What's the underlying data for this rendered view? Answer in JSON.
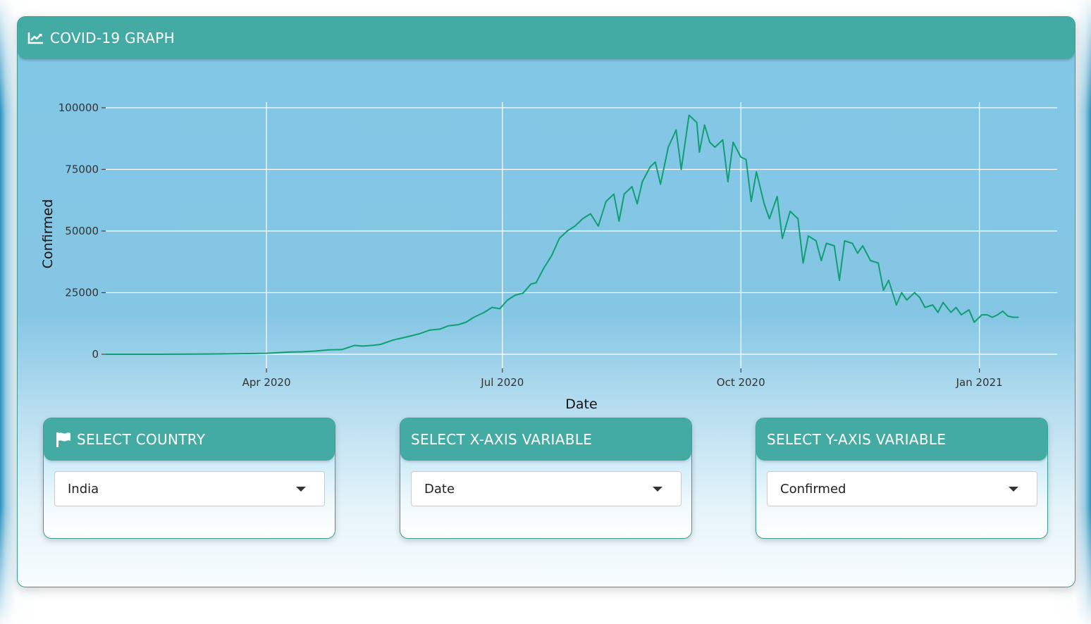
{
  "header": {
    "title": "COVID-19 GRAPH",
    "icon": "line-chart-icon"
  },
  "selectors": {
    "country": {
      "title": "SELECT COUNTRY",
      "icon": "flag-icon",
      "value": "India"
    },
    "x_axis": {
      "title": "SELECT X-AXIS VARIABLE",
      "value": "Date"
    },
    "y_axis": {
      "title": "SELECT Y-AXIS VARIABLE",
      "value": "Confirmed"
    }
  },
  "colors": {
    "accent": "#43aba4",
    "line": "#109f72",
    "grid": "#ffffff"
  },
  "chart_data": {
    "type": "line",
    "title": "",
    "xlabel": "Date",
    "ylabel": "Confirmed",
    "grid": true,
    "xlim": [
      "2020-01-30",
      "2021-01-31"
    ],
    "ylim": [
      0,
      100000
    ],
    "x_ticks": [
      {
        "date": "2020-04-01",
        "label": "Apr 2020"
      },
      {
        "date": "2020-07-01",
        "label": "Jul 2020"
      },
      {
        "date": "2020-10-01",
        "label": "Oct 2020"
      },
      {
        "date": "2021-01-01",
        "label": "Jan 2021"
      }
    ],
    "y_ticks": [
      {
        "value": 0,
        "label": "0"
      },
      {
        "value": 25000,
        "label": "25000"
      },
      {
        "value": 50000,
        "label": "50000"
      },
      {
        "value": 75000,
        "label": "75000"
      },
      {
        "value": 100000,
        "label": "100000"
      }
    ],
    "series": [
      {
        "x": [
          "2020-01-30",
          "2020-02-20",
          "2020-03-10",
          "2020-03-20",
          "2020-04-01",
          "2020-04-10",
          "2020-04-15",
          "2020-04-20",
          "2020-04-25",
          "2020-04-30",
          "2020-05-05",
          "2020-05-08",
          "2020-05-12",
          "2020-05-15",
          "2020-05-20",
          "2020-05-25",
          "2020-05-30",
          "2020-06-03",
          "2020-06-07",
          "2020-06-10",
          "2020-06-14",
          "2020-06-17",
          "2020-06-20",
          "2020-06-24",
          "2020-06-27",
          "2020-06-30",
          "2020-07-03",
          "2020-07-06",
          "2020-07-09",
          "2020-07-12",
          "2020-07-14",
          "2020-07-17",
          "2020-07-20",
          "2020-07-23",
          "2020-07-26",
          "2020-07-29",
          "2020-08-01",
          "2020-08-04",
          "2020-08-07",
          "2020-08-10",
          "2020-08-13",
          "2020-08-15",
          "2020-08-17",
          "2020-08-20",
          "2020-08-22",
          "2020-08-24",
          "2020-08-27",
          "2020-08-29",
          "2020-08-31",
          "2020-09-03",
          "2020-09-06",
          "2020-09-08",
          "2020-09-11",
          "2020-09-14",
          "2020-09-15",
          "2020-09-17",
          "2020-09-19",
          "2020-09-21",
          "2020-09-24",
          "2020-09-26",
          "2020-09-28",
          "2020-10-01",
          "2020-10-03",
          "2020-10-05",
          "2020-10-07",
          "2020-10-10",
          "2020-10-12",
          "2020-10-15",
          "2020-10-17",
          "2020-10-20",
          "2020-10-23",
          "2020-10-25",
          "2020-10-27",
          "2020-10-30",
          "2020-11-01",
          "2020-11-03",
          "2020-11-06",
          "2020-11-08",
          "2020-11-10",
          "2020-11-13",
          "2020-11-15",
          "2020-11-17",
          "2020-11-20",
          "2020-11-23",
          "2020-11-25",
          "2020-11-27",
          "2020-11-30",
          "2020-12-02",
          "2020-12-04",
          "2020-12-07",
          "2020-12-09",
          "2020-12-11",
          "2020-12-14",
          "2020-12-16",
          "2020-12-18",
          "2020-12-21",
          "2020-12-23",
          "2020-12-25",
          "2020-12-28",
          "2020-12-30",
          "2021-01-02",
          "2021-01-04",
          "2021-01-06",
          "2021-01-08",
          "2021-01-10",
          "2021-01-12",
          "2021-01-14",
          "2021-01-16"
        ],
        "y": [
          0,
          0,
          100,
          200,
          400,
          900,
          1000,
          1300,
          1800,
          1900,
          3600,
          3300,
          3600,
          4000,
          5800,
          7000,
          8300,
          9800,
          10200,
          11500,
          12000,
          13000,
          15000,
          17000,
          19000,
          18500,
          22000,
          24000,
          24800,
          28500,
          29000,
          35000,
          40000,
          47000,
          50000,
          52000,
          55000,
          57000,
          52000,
          62000,
          65000,
          54000,
          65000,
          68000,
          61000,
          70000,
          76000,
          78000,
          69000,
          84000,
          91000,
          75000,
          97000,
          94000,
          82000,
          93000,
          86000,
          84000,
          87000,
          70000,
          86000,
          80000,
          79000,
          62000,
          74000,
          61000,
          55000,
          64000,
          47000,
          58000,
          55000,
          37000,
          48000,
          46000,
          38000,
          45000,
          44000,
          30000,
          46000,
          45000,
          41000,
          44000,
          38000,
          37000,
          26000,
          30000,
          20000,
          25000,
          22000,
          25000,
          23000,
          19000,
          20000,
          17000,
          21000,
          17000,
          19000,
          16000,
          18000,
          13000,
          16000,
          16000,
          15000,
          16000,
          17500,
          15500,
          15000,
          15000
        ]
      }
    ]
  }
}
